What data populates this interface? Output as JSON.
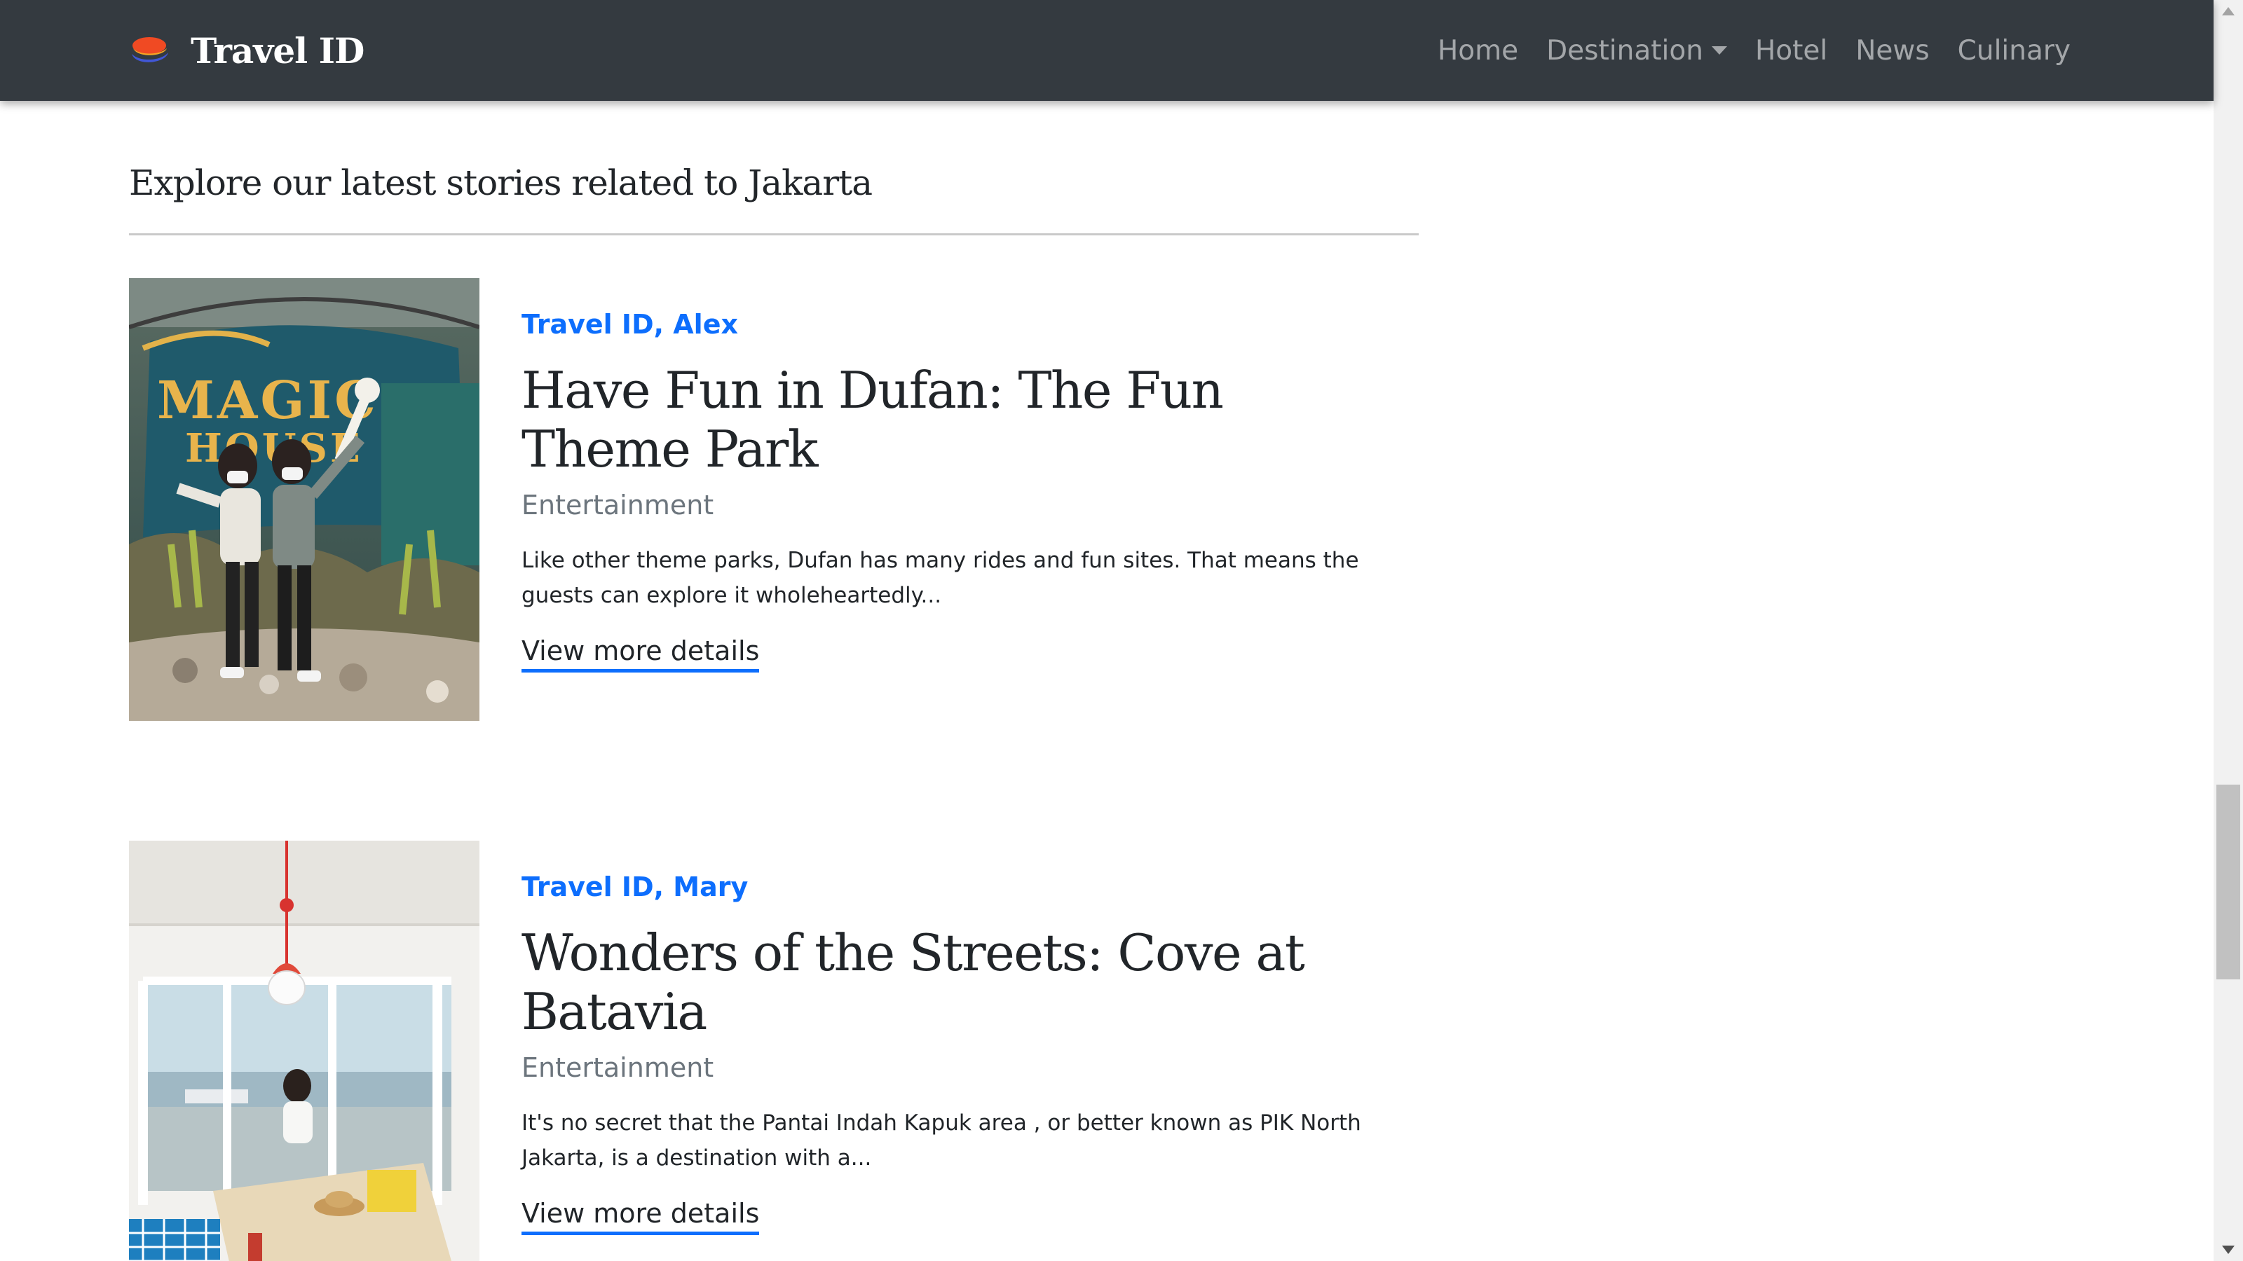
{
  "navbar": {
    "brand": "Travel ID",
    "links": {
      "home": "Home",
      "destination": "Destination",
      "hotel": "Hotel",
      "news": "News",
      "culinary": "Culinary"
    }
  },
  "section": {
    "title": "Explore our latest stories related to Jakarta"
  },
  "stories": [
    {
      "meta": "Travel ID, Alex",
      "title": "Have Fun in Dufan: The Fun Theme Park",
      "category": "Entertainment",
      "excerpt": "Like other theme parks, Dufan has many rides and fun sites. That means the guests can explore it wholeheartedly...",
      "link": "View more details"
    },
    {
      "meta": "Travel ID, Mary",
      "title": "Wonders of the Streets: Cove at Batavia",
      "category": "Entertainment",
      "excerpt": "It's no secret that the Pantai Indah Kapuk area , or better known as PIK North Jakarta, is a destination with a...",
      "link": "View more details"
    }
  ],
  "images": {
    "story_1_sign_text": "MAGIC HOUSE"
  },
  "colors": {
    "navbar_bg": "#343a40",
    "accent": "#0d6efd",
    "muted": "#6c757d",
    "text": "#212529"
  },
  "icons": {
    "brand": "travel-id-logo-icon",
    "dropdown": "caret-down-icon"
  }
}
